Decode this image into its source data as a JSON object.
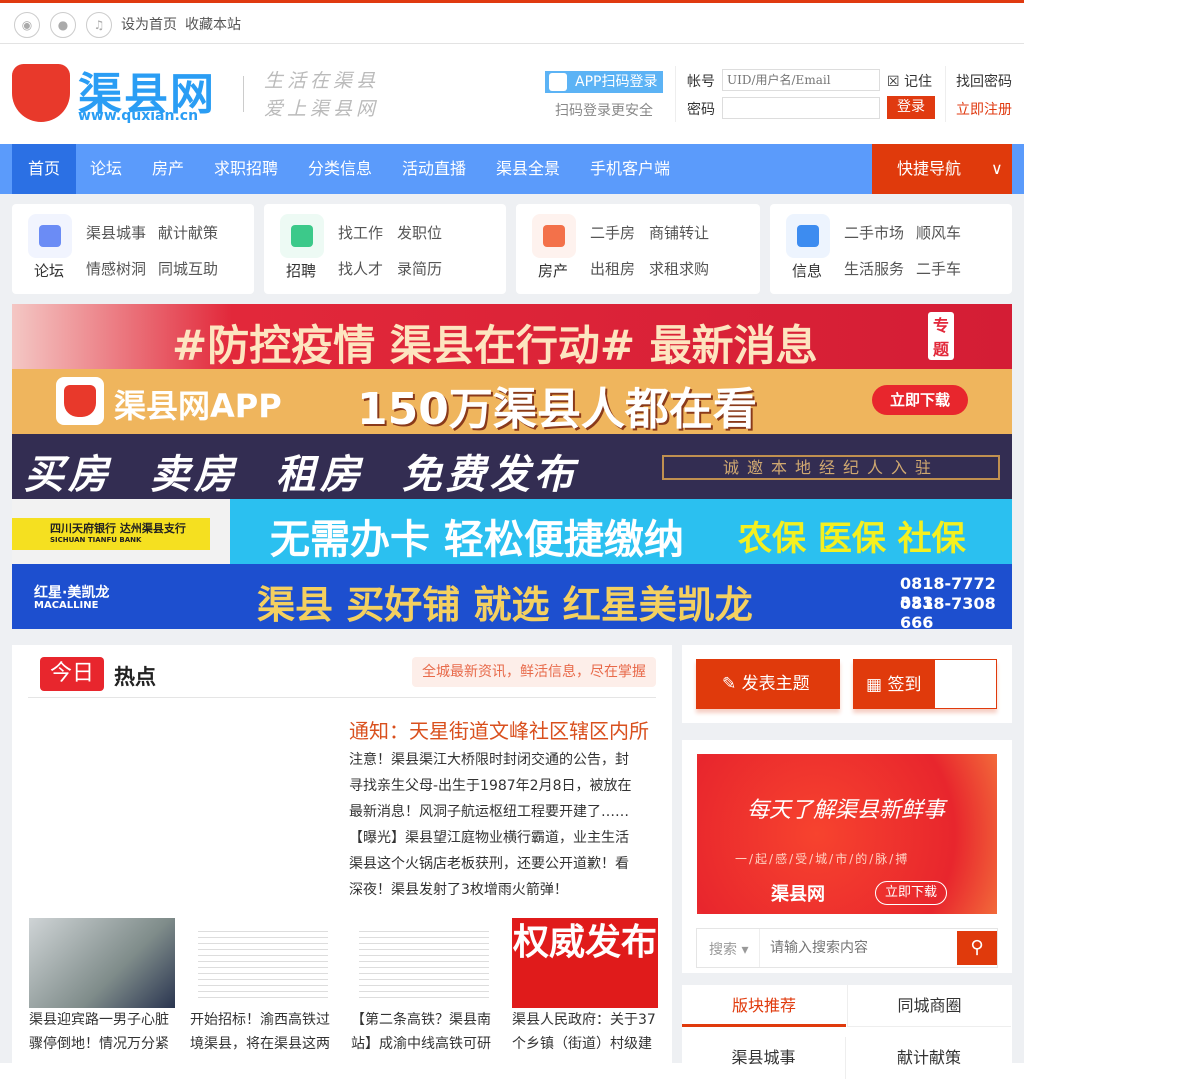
{
  "topbar": {
    "icons": [
      "weibo-icon",
      "wechat-icon",
      "service-icon"
    ],
    "links": [
      "设为首页",
      "收藏本站"
    ]
  },
  "header": {
    "logo_text": "渠县网",
    "logo_url": "www.quxian.cn",
    "slogan": [
      "生活在渠县",
      "爱上渠县网"
    ],
    "app_login": "APP扫码登录",
    "app_sub": "扫码登录更安全",
    "account_label": "帐号",
    "account_placeholder": "UID/用户名/Email",
    "password_label": "密码",
    "remember": "记住",
    "login_button": "登录",
    "find_password": "找回密码",
    "register": "立即注册"
  },
  "nav": {
    "items": [
      "首页",
      "论坛",
      "房产",
      "求职招聘",
      "分类信息",
      "活动直播",
      "渠县全景",
      "手机客户端"
    ],
    "quick": "快捷导航"
  },
  "cards": [
    {
      "label": "论坛",
      "links": [
        "渠县城事",
        "献计献策",
        "情感树洞",
        "同城互助"
      ],
      "color": "#6b8cf5"
    },
    {
      "label": "招聘",
      "links": [
        "找工作",
        "发职位",
        "找人才",
        "录简历"
      ],
      "color": "#3cc98a"
    },
    {
      "label": "房产",
      "links": [
        "二手房",
        "商铺转让",
        "出租房",
        "求租求购"
      ],
      "color": "#f3714a"
    },
    {
      "label": "信息",
      "links": [
        "二手市场",
        "顺风车",
        "生活服务",
        "二手车"
      ],
      "color": "#3d8cf0"
    }
  ],
  "banners": [
    {
      "text": "#防控疫情 渠县在行动# 最新消息",
      "tag": "专题"
    },
    {
      "app": "渠县网APP",
      "text": "150万渠县人都在看",
      "button": "立即下载"
    },
    {
      "text": "买房 卖房 租房 免费发布",
      "box": "诚邀本地经纪人入驻"
    },
    {
      "bank": "四川天府银行 达州渠县支行",
      "bank_en": "SICHUAN TIANFU BANK",
      "text": "无需办卡 轻松便捷缴纳",
      "right": "农保 医保 社保"
    },
    {
      "brand": "红星·美凯龙",
      "brand_en": "MACALLINE",
      "text": "渠县 买好铺 就选 红星美凯龙",
      "phone1": "0818-7772 333",
      "phone2": "0818-7308 666"
    }
  ],
  "hot": {
    "badge": "今日",
    "title": "热点",
    "tag": "全城最新资讯，鲜活信息，尽在掌握",
    "headline": "通知：天星街道文峰社区辖区内所",
    "list": [
      "注意！渠县渠江大桥限时封闭交通的公告，封",
      "寻找亲生父母-出生于1987年2月8日，被放在",
      "最新消息！风洞子航运枢纽工程要开建了……",
      "【曝光】渠县望江庭物业横行霸道，业主生活",
      "渠县这个火锅店老板获刑，还要公开道歉！看",
      "深夜！渠县发射了3枚增雨火箭弹！"
    ],
    "thumbs": [
      {
        "caption": "渠县迎宾路一男子心脏骤停倒地！情况万分紧"
      },
      {
        "caption": "开始招标！渝西高铁过境渠县，将在渠县这两"
      },
      {
        "caption": "【第二条高铁？渠县南站】成渝中线高铁可研"
      },
      {
        "caption": "渠县人民政府：关于37个乡镇（街道）村级建",
        "image_text": "权威发布"
      }
    ]
  },
  "side": {
    "post": "发表主题",
    "checkin": "签到",
    "ad": {
      "title": "每天了解渠县新鲜事",
      "sub": "一/起/感/受/城/市/的/脉/搏",
      "logo": "渠县网",
      "button": "立即下载"
    },
    "search": {
      "type": "搜索",
      "placeholder": "请输入搜索内容"
    },
    "tabs": [
      "版块推荐",
      "同城商圈"
    ],
    "items": [
      "渠县城事",
      "献计献策"
    ]
  }
}
